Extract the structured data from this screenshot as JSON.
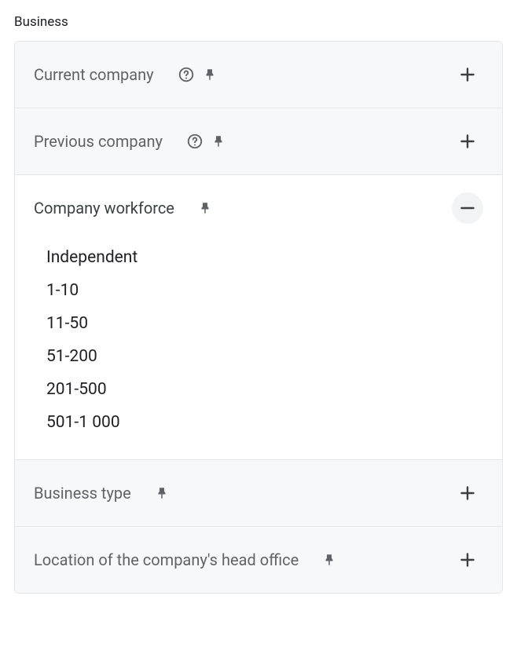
{
  "section": {
    "title": "Business"
  },
  "filters": {
    "current_company": {
      "label": "Current company"
    },
    "previous_company": {
      "label": "Previous company"
    },
    "company_workforce": {
      "label": "Company workforce",
      "options": [
        "Independent",
        "1-10",
        "11-50",
        "51-200",
        "201-500",
        "501-1 000"
      ]
    },
    "business_type": {
      "label": "Business type"
    },
    "head_office_location": {
      "label": "Location of the company's head office"
    }
  }
}
